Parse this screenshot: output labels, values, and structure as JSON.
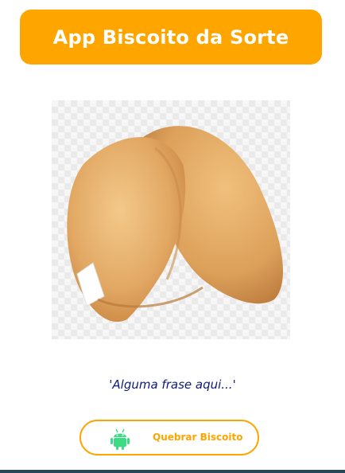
{
  "header": {
    "title": "App Biscoito da Sorte",
    "color": "#FFA500"
  },
  "image": {
    "name": "fortune-cookie-image"
  },
  "phrase": {
    "text": "'Alguma frase aqui...'",
    "color": "#0d1b7a"
  },
  "button": {
    "label": "Quebrar Biscoito",
    "icon": "android-icon",
    "border_color": "#FFA500",
    "icon_color": "#3DDC84"
  }
}
